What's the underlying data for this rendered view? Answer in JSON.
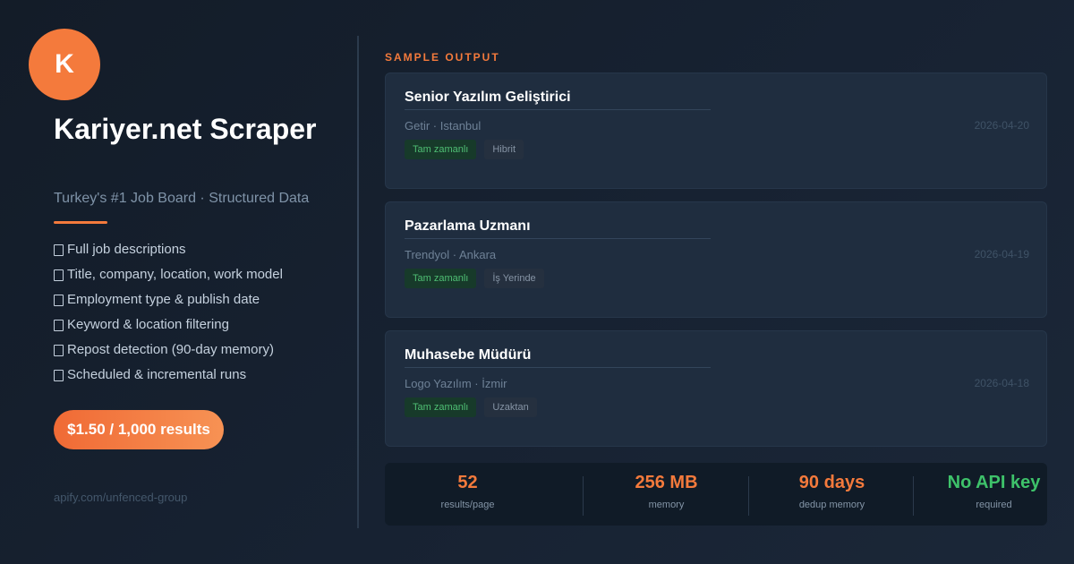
{
  "brand": {
    "logo_letter": "K",
    "title": "Kariyer.net Scraper",
    "tagline": "Turkey's #1 Job Board · Structured Data",
    "accent_color": "#f47a3c"
  },
  "features": [
    "Full job descriptions",
    "Title, company, location, work model",
    "Employment type & publish date",
    "Keyword & location filtering",
    "Repost detection (90-day memory)",
    "Scheduled & incremental runs"
  ],
  "price_label": "$1.50 / 1,000 results",
  "footer_link": "apify.com/unfenced-group",
  "sample": {
    "section_label": "SAMPLE OUTPUT",
    "jobs": [
      {
        "title": "Senior Yazılım Geliştirici",
        "company": "Getir",
        "location": "Istanbul",
        "date": "2026-04-20",
        "employment_type": "Tam zamanlı",
        "work_model": "Hibrit"
      },
      {
        "title": "Pazarlama Uzmanı",
        "company": "Trendyol",
        "location": "Ankara",
        "date": "2026-04-19",
        "employment_type": "Tam zamanlı",
        "work_model": "İş Yerinde"
      },
      {
        "title": "Muhasebe Müdürü",
        "company": "Logo Yazılım",
        "location": "İzmir",
        "date": "2026-04-18",
        "employment_type": "Tam zamanlı",
        "work_model": "Uzaktan"
      }
    ]
  },
  "stats": [
    {
      "value": "52",
      "label": "results/page",
      "color": "#f47a3c"
    },
    {
      "value": "256 MB",
      "label": "memory",
      "color": "#f47a3c"
    },
    {
      "value": "90 days",
      "label": "dedup memory",
      "color": "#f47a3c"
    },
    {
      "value": "No API key",
      "label": "required",
      "color": "#3ec26a"
    }
  ]
}
